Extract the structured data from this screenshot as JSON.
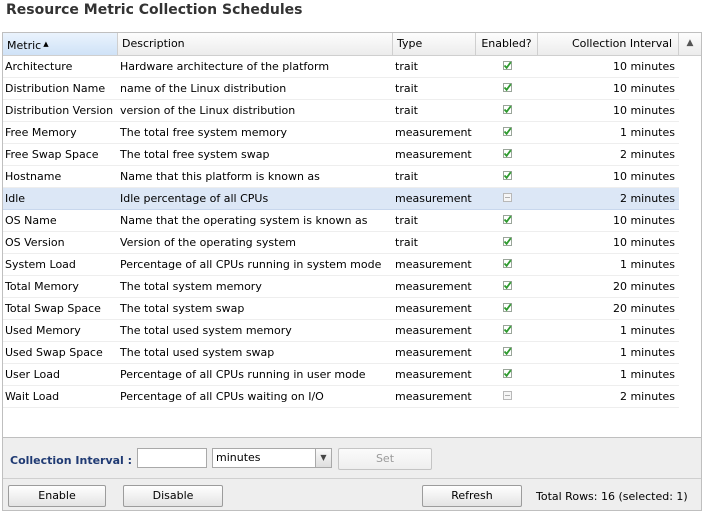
{
  "page_title": "Resource Metric Collection Schedules",
  "columns": {
    "metric": "Metric",
    "description": "Description",
    "type": "Type",
    "enabled": "Enabled?",
    "interval": "Collection Interval"
  },
  "rows": [
    {
      "metric": "Architecture",
      "description": "Hardware architecture of the platform",
      "type": "trait",
      "enabled": true,
      "interval": "10 minutes"
    },
    {
      "metric": "Distribution Name",
      "description": "name of the Linux distribution",
      "type": "trait",
      "enabled": true,
      "interval": "10 minutes"
    },
    {
      "metric": "Distribution Version",
      "description": "version of the Linux distribution",
      "type": "trait",
      "enabled": true,
      "interval": "10 minutes"
    },
    {
      "metric": "Free Memory",
      "description": "The total free system memory",
      "type": "measurement",
      "enabled": true,
      "interval": "1 minutes"
    },
    {
      "metric": "Free Swap Space",
      "description": "The total free system swap",
      "type": "measurement",
      "enabled": true,
      "interval": "2 minutes"
    },
    {
      "metric": "Hostname",
      "description": "Name that this platform is known as",
      "type": "trait",
      "enabled": true,
      "interval": "10 minutes"
    },
    {
      "metric": "Idle",
      "description": "Idle percentage of all CPUs",
      "type": "measurement",
      "enabled": false,
      "interval": "2 minutes",
      "selected": true
    },
    {
      "metric": "OS Name",
      "description": "Name that the operating system is known as",
      "type": "trait",
      "enabled": true,
      "interval": "10 minutes"
    },
    {
      "metric": "OS Version",
      "description": "Version of the operating system",
      "type": "trait",
      "enabled": true,
      "interval": "10 minutes"
    },
    {
      "metric": "System Load",
      "description": "Percentage of all CPUs running in system mode",
      "type": "measurement",
      "enabled": true,
      "interval": "1 minutes"
    },
    {
      "metric": "Total Memory",
      "description": "The total system memory",
      "type": "measurement",
      "enabled": true,
      "interval": "20 minutes"
    },
    {
      "metric": "Total Swap Space",
      "description": "The total system swap",
      "type": "measurement",
      "enabled": true,
      "interval": "20 minutes"
    },
    {
      "metric": "Used Memory",
      "description": "The total used system memory",
      "type": "measurement",
      "enabled": true,
      "interval": "1 minutes"
    },
    {
      "metric": "Used Swap Space",
      "description": "The total used system swap",
      "type": "measurement",
      "enabled": true,
      "interval": "1 minutes"
    },
    {
      "metric": "User Load",
      "description": "Percentage of all CPUs running in user mode",
      "type": "measurement",
      "enabled": true,
      "interval": "1 minutes"
    },
    {
      "metric": "Wait Load",
      "description": "Percentage of all CPUs waiting on I/O",
      "type": "measurement",
      "enabled": false,
      "interval": "2 minutes"
    }
  ],
  "footer": {
    "collection_interval_label": "Collection Interval :",
    "interval_value": "",
    "unit_selected": "minutes",
    "set_label": "Set",
    "enable_label": "Enable",
    "disable_label": "Disable",
    "refresh_label": "Refresh",
    "status": "Total Rows: 16 (selected: 1)"
  },
  "icons": {
    "sort": "sort-ascending-icon",
    "scroll_corner": "scroll-up-icon",
    "enabled": "check-icon",
    "disabled": "unchecked-icon",
    "dropdown": "chevron-down-icon"
  },
  "colors": {
    "selected_row": "#dce7f6",
    "check_green": "#2e9a2e",
    "label_blue": "#1f3a73"
  }
}
